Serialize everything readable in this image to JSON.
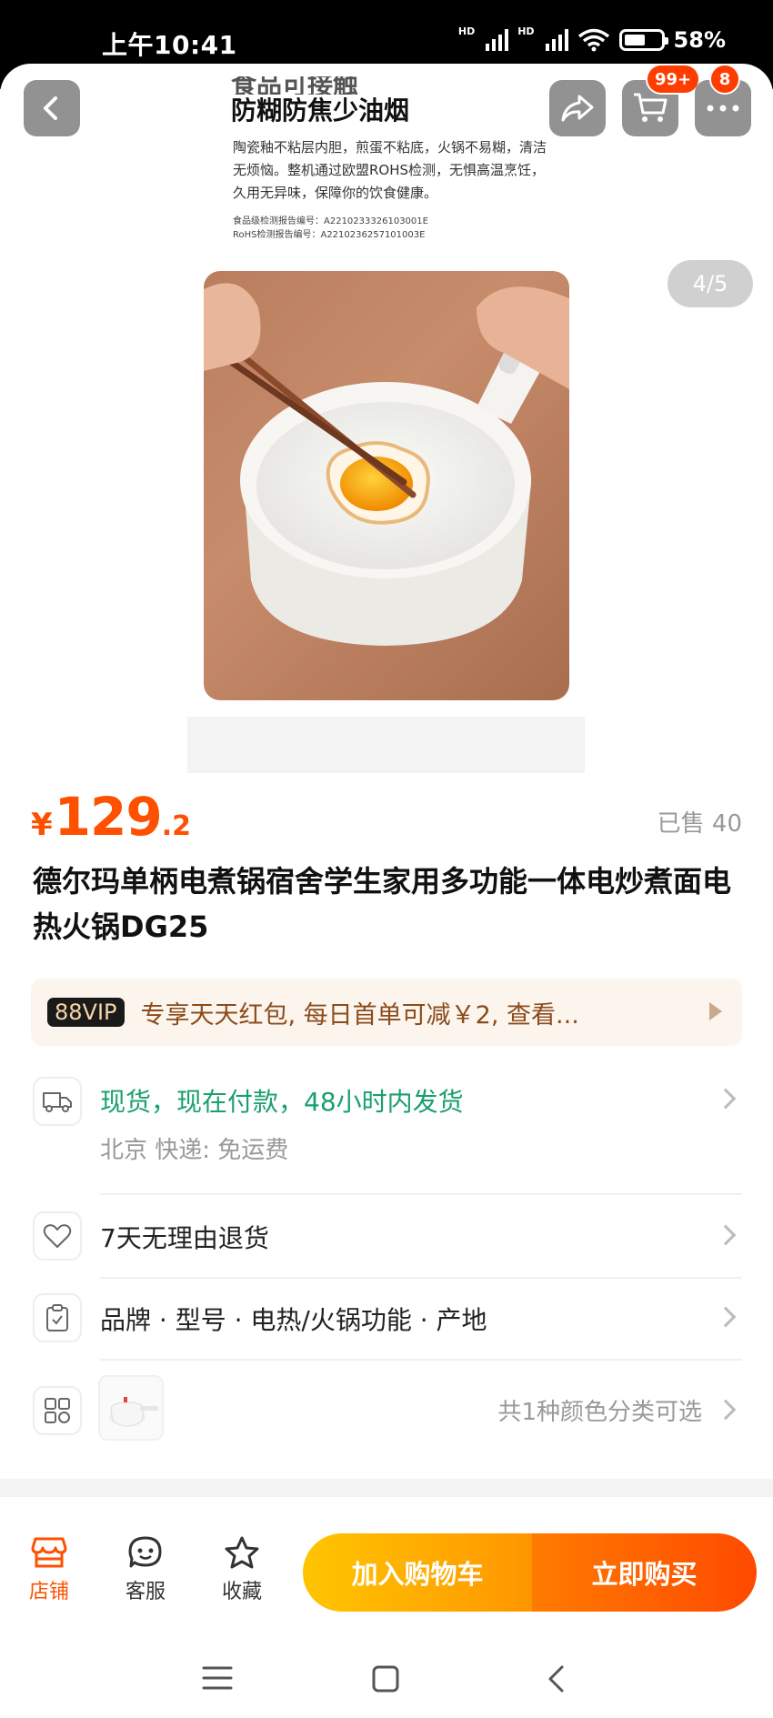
{
  "status_bar": {
    "time": "上午10:41",
    "battery": "58%",
    "battery_level": 0.58,
    "network": "HD"
  },
  "gallery": {
    "promo_heading_cut": "食品可接触",
    "promo_heading": "防糊防焦少油烟",
    "promo_body": "陶瓷釉不粘层内胆，煎蛋不粘底，火锅不易糊，清洁无烦恼。整机通过欧盟ROHS检测，无惧高温烹饪，久用无异味，保障你的饮食健康。",
    "promo_note_1": "食品级检测报告编号：A2210233326103001E",
    "promo_note_2": "RoHS检测报告编号：A2210236257101003E",
    "pager": "4/5",
    "cart_badge": "99+",
    "message_badge": "8"
  },
  "product": {
    "currency": "¥",
    "price_int": "129",
    "price_dec": ".2",
    "sold": "已售 40",
    "title": "德尔玛单柄电煮锅宿舍学生家用多功能一体电炒煮面电热火锅DG25"
  },
  "vip": {
    "tag": "88VIP",
    "text": "专享天天红包, 每日首单可减￥2, 查看..."
  },
  "shipping": {
    "main": "现货，现在付款，48小时内发货",
    "sub": "北京  快递:  免运费"
  },
  "returns": {
    "text": "7天无理由退货"
  },
  "params": {
    "text": "品牌 · 型号 · 电热/火锅功能 · 产地"
  },
  "variants": {
    "text": "共1种颜色分类可选"
  },
  "actions": {
    "store": "店铺",
    "service": "客服",
    "favorite": "收藏",
    "add_to_cart": "加入购物车",
    "buy_now": "立即购买"
  },
  "colors": {
    "accent": "#ff5000",
    "ship_green": "#1aa06d",
    "cart_start": "#ffc500",
    "buy_end": "#ff4a00"
  }
}
